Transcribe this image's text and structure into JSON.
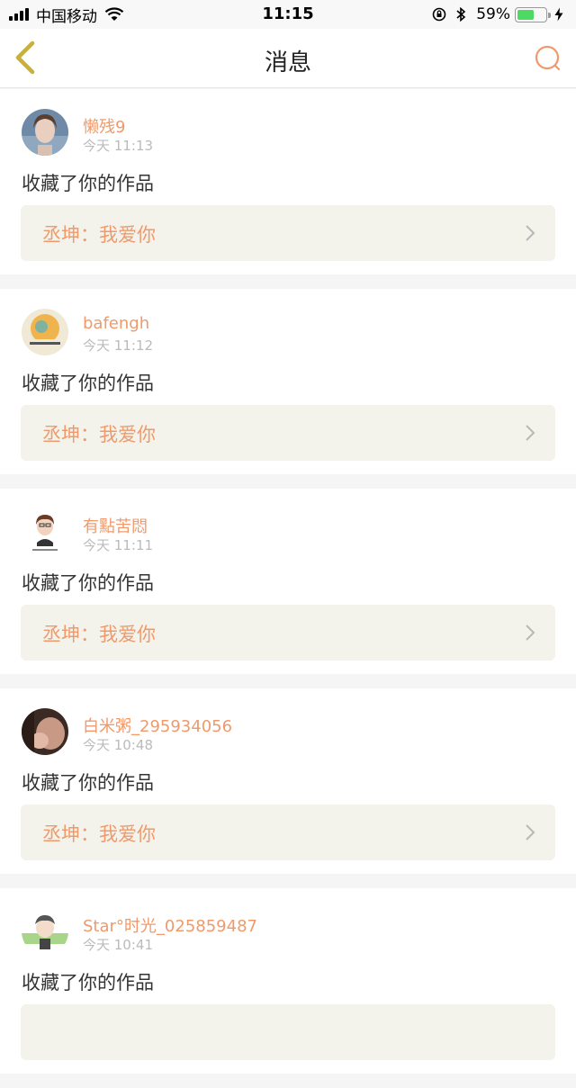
{
  "status_bar": {
    "carrier": "中国移动",
    "time": "11:15",
    "battery_percent": "59%",
    "battery_level": 0.59
  },
  "nav": {
    "title": "消息",
    "back_icon": "chevron-left-icon",
    "search_icon": "search-icon",
    "accent_color": "#f09a6b"
  },
  "messages": [
    {
      "user": "懒残9",
      "time": "今天 11:13",
      "action": "收藏了你的作品",
      "work": "丞坤：我爱你"
    },
    {
      "user": "bafengh",
      "time": "今天 11:12",
      "action": "收藏了你的作品",
      "work": "丞坤：我爱你"
    },
    {
      "user": "有點苦悶",
      "time": "今天 11:11",
      "action": "收藏了你的作品",
      "work": "丞坤：我爱你"
    },
    {
      "user": "白米粥_295934056",
      "time": "今天 10:48",
      "action": "收藏了你的作品",
      "work": "丞坤：我爱你"
    },
    {
      "user": "Star°时光_025859487",
      "time": "今天 10:41",
      "action": "收藏了你的作品",
      "work": ""
    }
  ]
}
